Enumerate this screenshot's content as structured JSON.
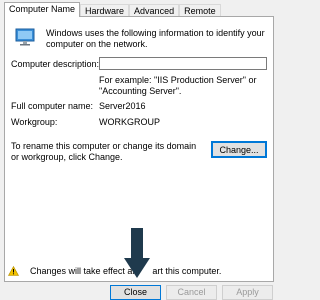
{
  "tabs": [
    {
      "label": "Computer Name",
      "active": true
    },
    {
      "label": "Hardware",
      "active": false
    },
    {
      "label": "Advanced",
      "active": false
    },
    {
      "label": "Remote",
      "active": false
    }
  ],
  "intro_text": "Windows uses the following information to identify your computer on the network.",
  "description": {
    "label": "Computer description:",
    "value": "",
    "example": "For example: \"IIS Production Server\" or \"Accounting Server\"."
  },
  "full_name": {
    "label": "Full computer name:",
    "value": "Server2016"
  },
  "workgroup": {
    "label": "Workgroup:",
    "value": "WORKGROUP"
  },
  "rename_text": "To rename this computer or change its domain or workgroup, click Change.",
  "change_button": "Change...",
  "warning": {
    "left": "Changes will take effect aft",
    "right": "art this computer."
  },
  "buttons": {
    "close": "Close",
    "cancel": "Cancel",
    "apply": "Apply"
  },
  "colors": {
    "accent": "#0078d7",
    "arrow": "#1f3a4d",
    "warning": "#f2c200"
  },
  "icons": {
    "computer": "computer-icon",
    "warning": "warning-icon",
    "annotation": "arrow-down-icon"
  }
}
